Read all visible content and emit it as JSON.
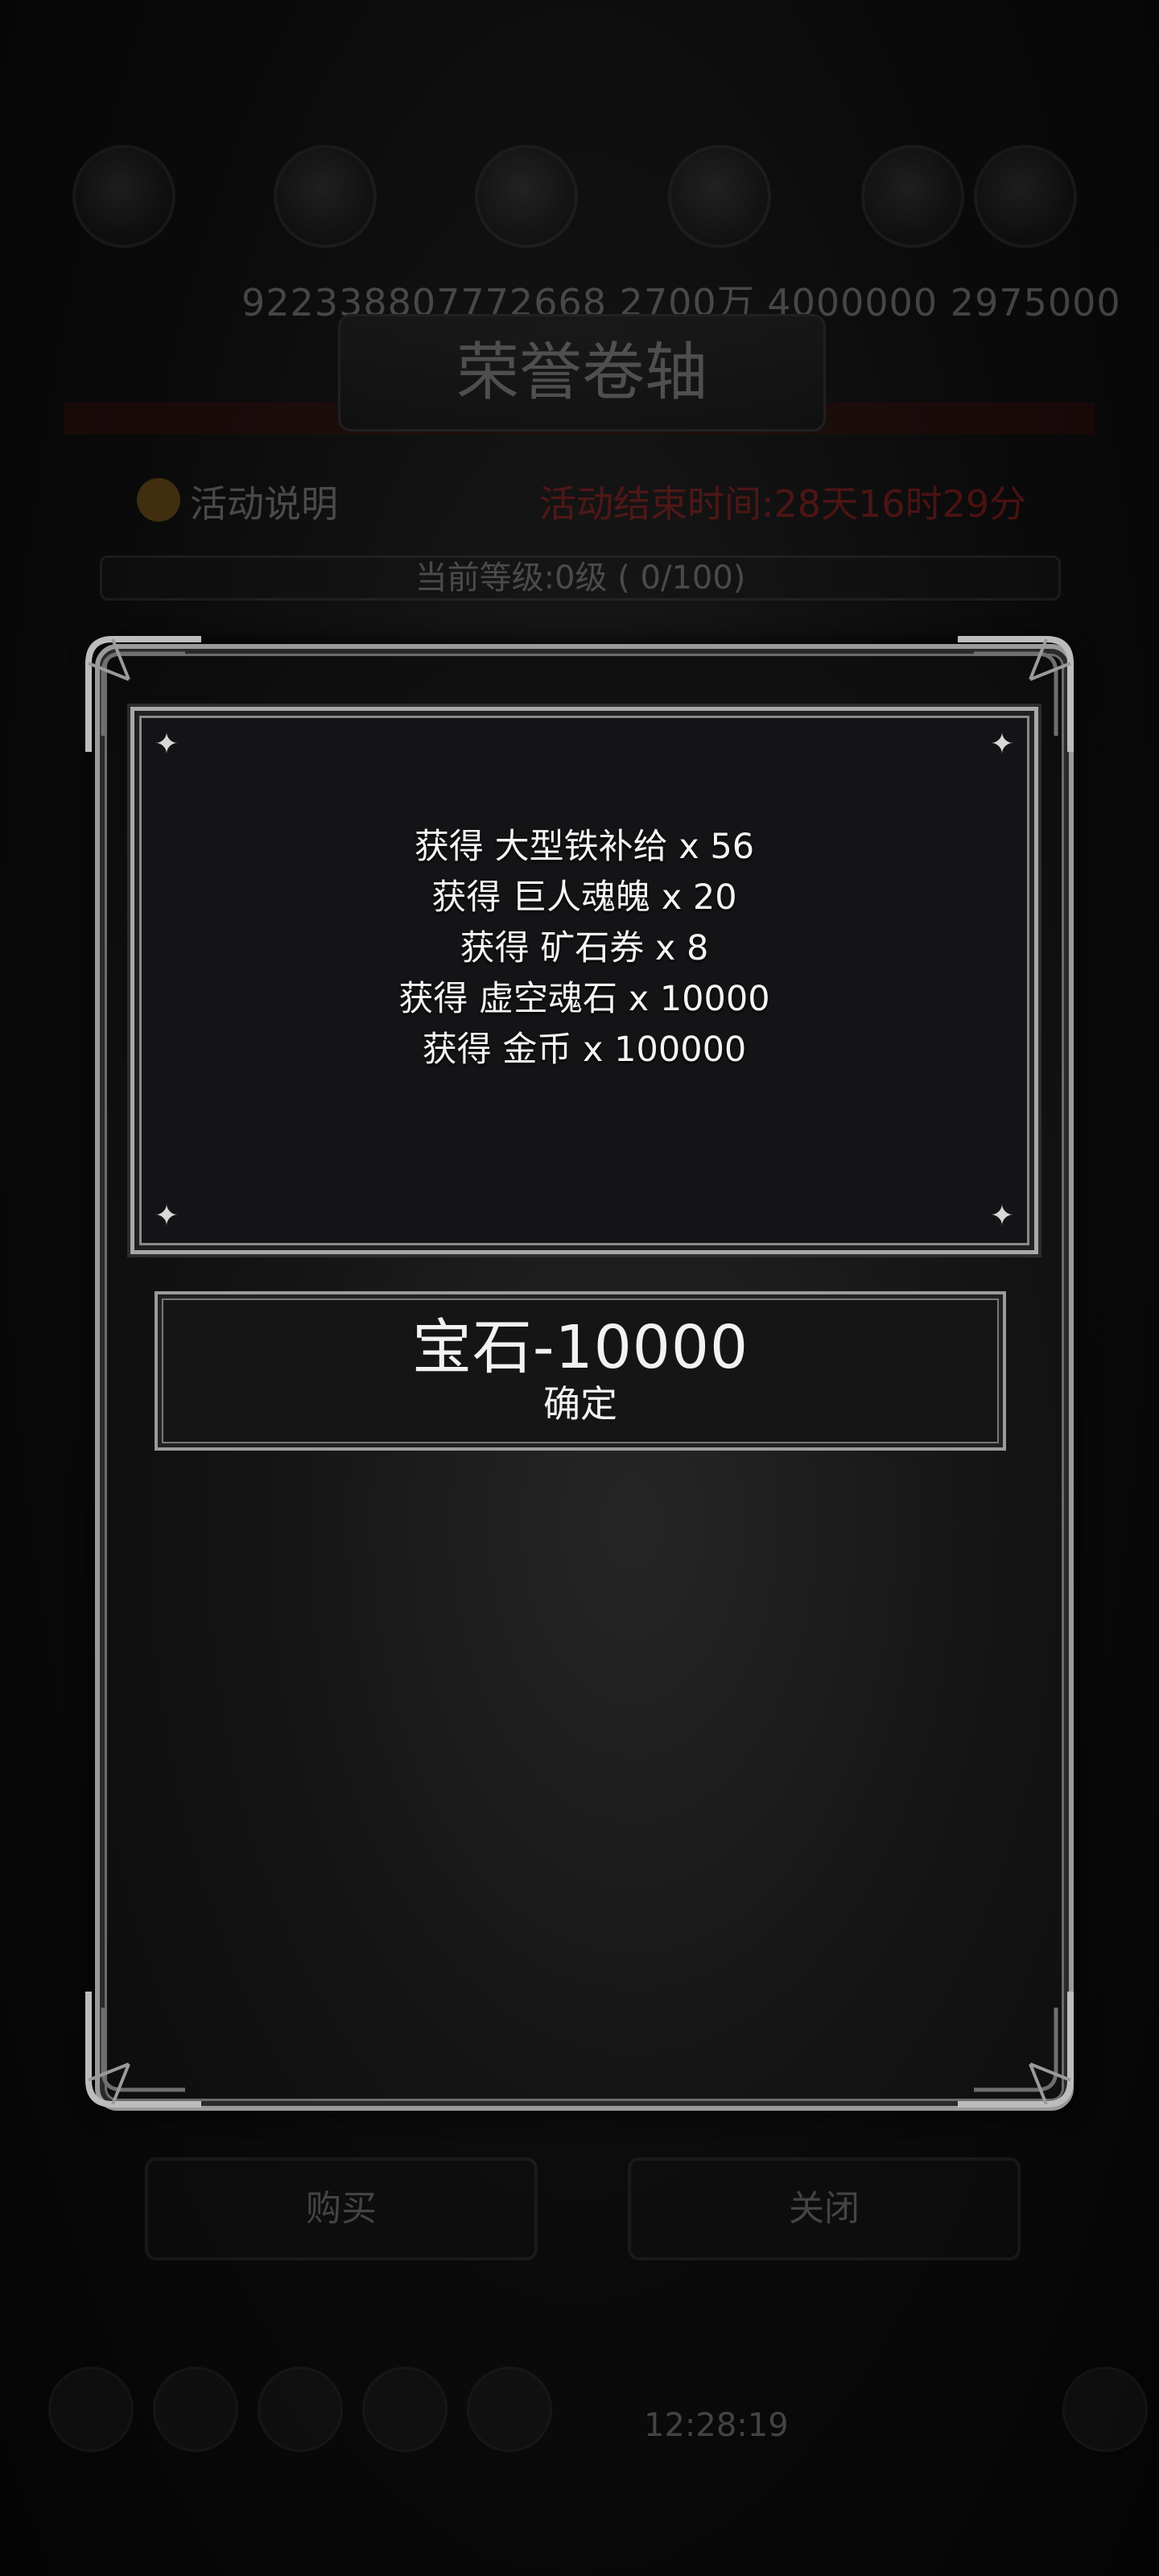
{
  "background": {
    "resource_values": "922338807772668 2700万 4000000 2975000",
    "title": "荣誉卷轴",
    "activity_info_label": "活动说明",
    "activity_end_time": "活动结束时间:28天16时29分",
    "current_level": "当前等级:0级 ( 0/100)",
    "buy_button": "购买",
    "close_button": "关闭",
    "clock": "12:28:19"
  },
  "dialog": {
    "rewards": [
      "获得 大型铁补给 x 56",
      "获得 巨人魂魄 x 20",
      "获得 矿石券 x 8",
      "获得 虚空魂石 x 10000",
      "获得 金币 x 100000"
    ],
    "cost": "宝石-10000",
    "confirm_label": "确定"
  },
  "colors": {
    "background": "#050505",
    "frame": "#9a9a9a",
    "text": "#f4f4f4",
    "end_time_red": "#d02020"
  }
}
